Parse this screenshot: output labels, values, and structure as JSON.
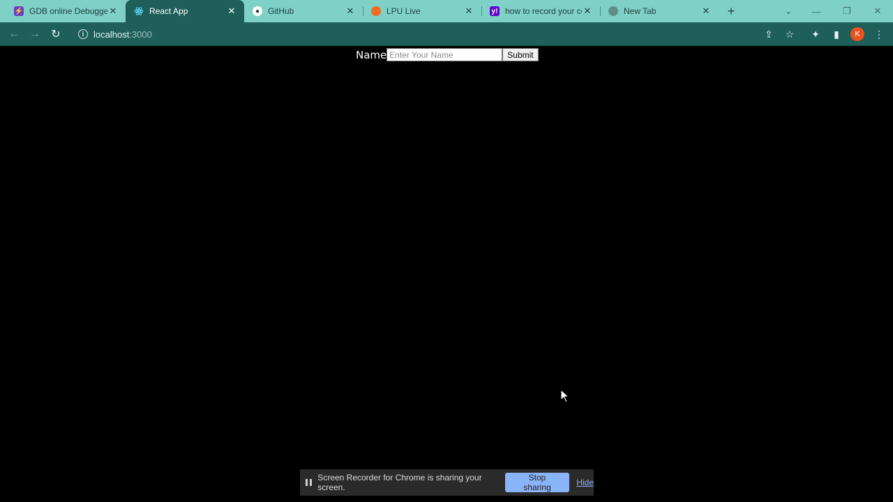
{
  "browser": {
    "tabs": [
      {
        "title": "GDB online Debugger",
        "icon": "bolt-icon",
        "color": "#6c3fc8"
      },
      {
        "title": "React App",
        "icon": "react-icon",
        "color": "#61dafb"
      },
      {
        "title": "GitHub",
        "icon": "github-icon",
        "color": "#ffffff"
      },
      {
        "title": "LPU Live",
        "icon": "lpu-icon",
        "color": "#f26c21"
      },
      {
        "title": "how to record your co",
        "icon": "yahoo-icon",
        "color": "#6001d2"
      },
      {
        "title": "New Tab",
        "icon": "globe-icon",
        "color": "#5f8f8a"
      }
    ],
    "url_host": "localhost",
    "url_port": ":3000",
    "profile_initial": "K"
  },
  "form": {
    "label": "Name",
    "placeholder": "Enter Your Name",
    "submit_label": "Submit"
  },
  "share_bar": {
    "message": "Screen Recorder for Chrome is sharing your screen.",
    "stop_label": "Stop sharing",
    "hide_label": "Hide"
  },
  "colors": {
    "tabstrip": "#7fd0c6",
    "toolbar": "#1f5f5a",
    "page_bg": "#000000",
    "share_button": "#8ab4f8"
  }
}
